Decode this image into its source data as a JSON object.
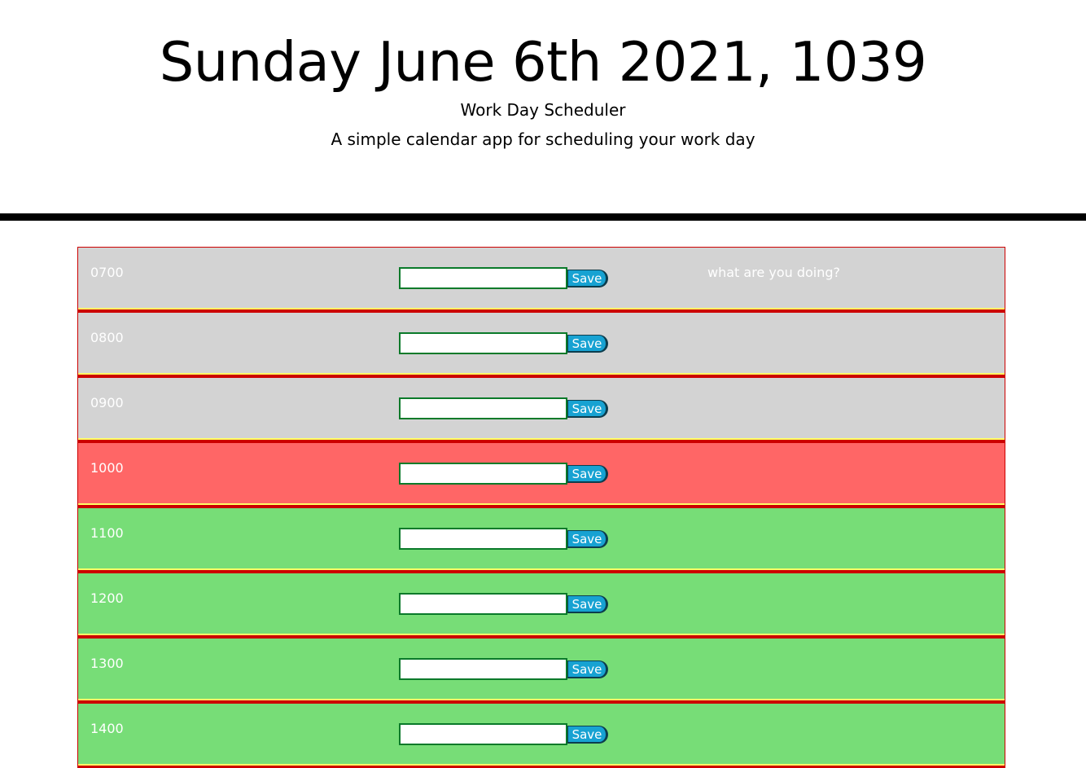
{
  "header": {
    "date_time": "Sunday June 6th 2021, 1039",
    "title": "Work Day Scheduler",
    "subtitle": "A simple calendar app for scheduling your work day"
  },
  "scheduler": {
    "save_label": "Save",
    "hint_text": "what are you doing?",
    "rows": [
      {
        "hour": "0700",
        "status": "past",
        "value": ""
      },
      {
        "hour": "0800",
        "status": "past",
        "value": ""
      },
      {
        "hour": "0900",
        "status": "past",
        "value": ""
      },
      {
        "hour": "1000",
        "status": "present",
        "value": ""
      },
      {
        "hour": "1100",
        "status": "future",
        "value": ""
      },
      {
        "hour": "1200",
        "status": "future",
        "value": ""
      },
      {
        "hour": "1300",
        "status": "future",
        "value": ""
      },
      {
        "hour": "1400",
        "status": "future",
        "value": ""
      }
    ]
  },
  "colors": {
    "past": "#d3d3d3",
    "present": "#ff6666",
    "future": "#77dd77",
    "save_button": "#17a2d2",
    "row_border": "#cc0000",
    "input_border": "#0a7a2a"
  }
}
